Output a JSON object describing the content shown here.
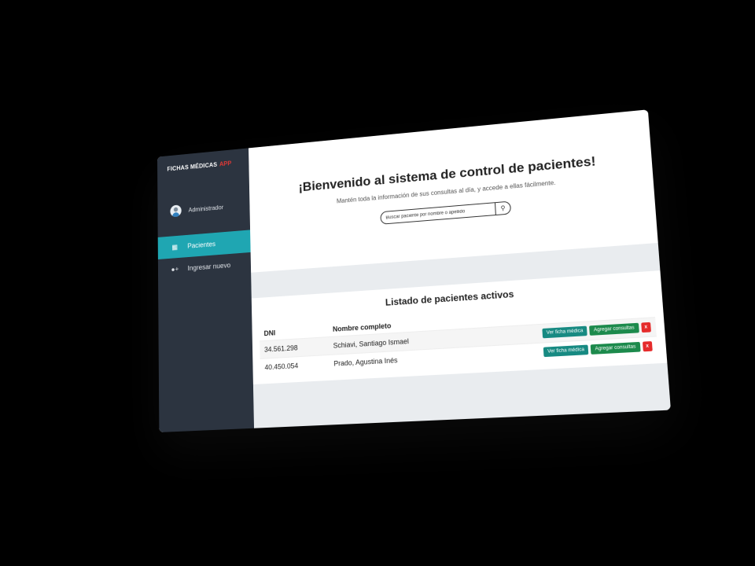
{
  "app": {
    "brand": "FICHAS MÉDICAS",
    "brand_accent": "APP",
    "accent_color": "#1fa6b2",
    "sidebar_color": "#2c3440",
    "user_name": "Administrador",
    "nav": [
      {
        "label": "Pacientes",
        "icon": "patients-icon",
        "active": true
      },
      {
        "label": "Ingresar nuevo",
        "icon": "add-user-icon",
        "active": false
      }
    ]
  },
  "main": {
    "hero_title": "¡Bienvenido al sistema de control de pacientes!",
    "hero_subtitle": "Mantén toda la información de sus consultas al día, y accede a ellas fácilmente.",
    "search_placeholder": "Buscar paciente por nombre o apellido",
    "list_title": "Listado de pacientes activos",
    "columns": [
      "DNI",
      "Nombre completo",
      ""
    ],
    "rows": [
      {
        "dni": "34.561.298",
        "name": "Schiavi, Santiago Ismael"
      },
      {
        "dni": "40.450.054",
        "name": "Prado, Agustina Inés"
      }
    ],
    "actions": {
      "view": "Ver ficha médica",
      "add": "Agregar consultas",
      "delete": "x"
    }
  }
}
